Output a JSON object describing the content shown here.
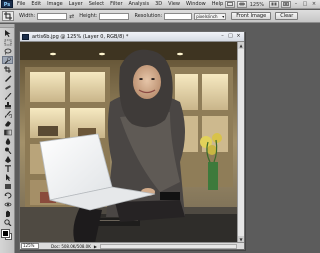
{
  "app": {
    "logo_text": "Ps",
    "menu": [
      "File",
      "Edit",
      "Image",
      "Layer",
      "Select",
      "Filter",
      "Analysis",
      "3D",
      "View",
      "Window",
      "Help"
    ],
    "zoom_readout": "125%",
    "window_controls": [
      "–",
      "□",
      "×"
    ]
  },
  "options": {
    "width_label": "Width:",
    "width_value": "",
    "height_label": "Height:",
    "height_value": "",
    "resolution_label": "Resolution:",
    "resolution_value": "",
    "resolution_unit": "pixels/inch",
    "front_image_label": "Front Image",
    "clear_label": "Clear"
  },
  "tools": [
    "move",
    "marquee",
    "lasso",
    "quick-select",
    "crop",
    "eyedropper",
    "healing-brush",
    "brush",
    "clone-stamp",
    "history-brush",
    "eraser",
    "gradient",
    "blur",
    "dodge",
    "pen",
    "type",
    "path-select",
    "shape",
    "3d-rotate",
    "3d-orbit",
    "hand",
    "zoom"
  ],
  "colors": {
    "foreground": "#000000",
    "background": "#ffffff"
  },
  "document": {
    "title": "artis6b.jpg @ 125% (Layer 0, RGB/8) *",
    "zoom": "125%",
    "status_info": "Doc: 508.0K/508.0K"
  }
}
